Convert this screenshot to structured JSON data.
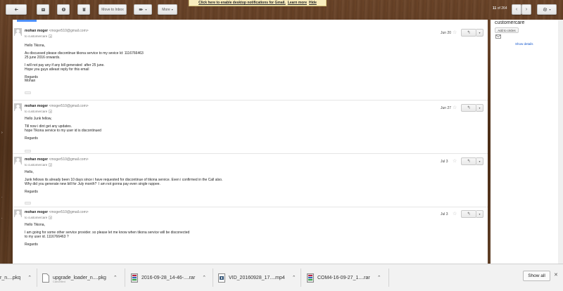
{
  "notification": {
    "message": "Click here to enable desktop notifications for Gmail.",
    "learn_more": "Learn more",
    "hide": "Hide"
  },
  "toolbar": {
    "move_label": "Move to Inbox",
    "more_label": "More",
    "pager_current": "11",
    "pager_of": "of",
    "pager_total": "264"
  },
  "contact": {
    "name": "customercare",
    "add_to_circles": "Add to circles",
    "show_details": "Show details"
  },
  "messages": [
    {
      "sender_name": "mohan moger",
      "sender_email": "<moger510@gmail.com>",
      "to": "to customercare",
      "date": "Jun 20",
      "body": "Hello Tikona,\n\nAs discussed please discontinue tikona service to my sevice Id: 1116766463\n25 june 2016 onwards.\n\nI will not pay any if any bill generated  after 25 june.\nHope you guys atleast reply for this email\n\nRegards\nMohan"
    },
    {
      "sender_name": "mohan moger",
      "sender_email": "<moger510@gmail.com>",
      "to": "to customercare",
      "date": "Jun 27",
      "body": "Hello Junk fellow,\n\nTill now i dint get any updates.\nhope Tikona service to my user id is discontinued\n\nRegards"
    },
    {
      "sender_name": "mohan moger",
      "sender_email": "<moger510@gmail.com>",
      "to": "to customercare",
      "date": "Jul 3",
      "body": "Hello,\n\nJunk fellows its already been 10 days since i have requested for discontinue of tikona service. Even i confirmed in the Call also.\nWhy did you generate new bill for July month?  I am not gonna pay even single ruppee.\n\nRegards"
    },
    {
      "sender_name": "mohan moger",
      "sender_email": "<moger510@gmail.com>",
      "to": "to customercare",
      "date": "Jul 3",
      "body": "Hello Tikona,\n\nI am going for some other service provider. so please let me know when tikona service will be disconected\nto my user id. 1116766463 ?\n\nRegards"
    }
  ],
  "downloads": {
    "items": [
      {
        "name": "r_n....pkq"
      },
      {
        "name": "upgrade_loader_n....pkg",
        "sub": "Cancelled"
      },
      {
        "name": "2016-09-28_14-46-....rar"
      },
      {
        "name": "VID_20160928_17....mp4"
      },
      {
        "name": "COM4-16-09-27_1....rar"
      }
    ],
    "show_all": "Show all"
  },
  "colors": {
    "accent": "#4d90fe",
    "link": "#1155cc",
    "notification_bg": "#f9edbe"
  }
}
